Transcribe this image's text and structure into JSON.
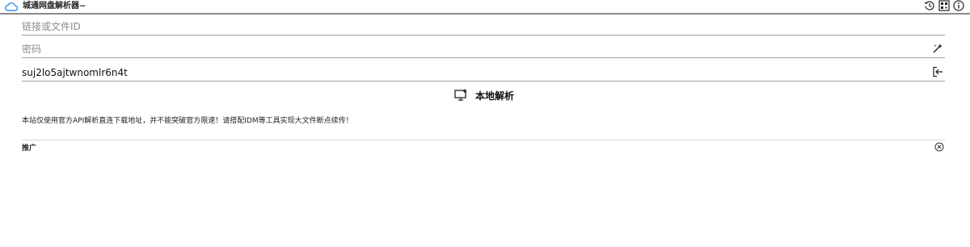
{
  "app": {
    "title": "城通网盘解析器~",
    "toolbar_icons": [
      "history-icon",
      "qr-code-icon",
      "info-icon"
    ]
  },
  "form": {
    "link_field": {
      "placeholder": "链接或文件ID",
      "value": ""
    },
    "password_field": {
      "placeholder": "密码",
      "value": "",
      "icon": "magic-wand-icon"
    },
    "token_field": {
      "placeholder": "",
      "value": "suj2lo5ajtwnomlr6n4t",
      "icon": "logout-icon"
    }
  },
  "action": {
    "label": "本地解析",
    "icon": "monitor-parse-icon"
  },
  "notice": "本站仅使用官方API解析直连下载地址，并不能突破官方限速！请搭配IDM等工具实现大文件断点续传！",
  "promo": {
    "label": "推广",
    "close_icon": "close-circle-icon"
  },
  "colors": {
    "divider": "#8a8a8a",
    "text": "#222222",
    "placeholder": "#8c8c8c",
    "accent": "#3a8ee6"
  }
}
